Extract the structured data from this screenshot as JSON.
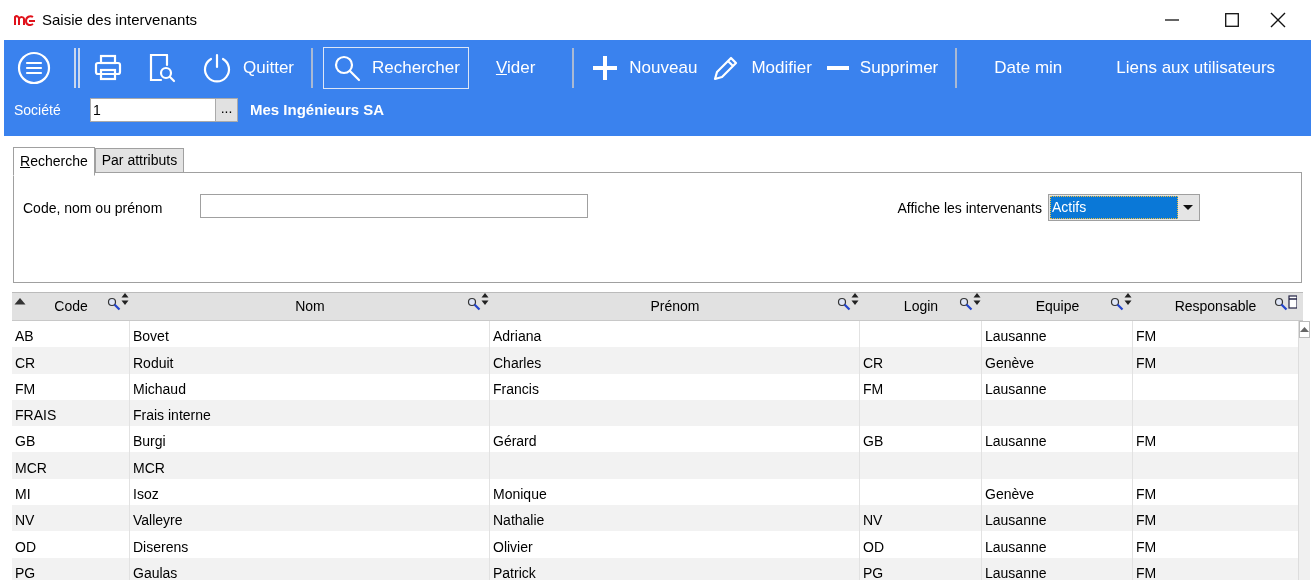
{
  "window": {
    "title": "Saisie des intervenants"
  },
  "toolbar": {
    "items": [
      {
        "kind": "menu"
      },
      {
        "kind": "separator"
      },
      {
        "kind": "print"
      },
      {
        "kind": "preview"
      },
      {
        "kind": "power",
        "label": "Quitter"
      },
      {
        "kind": "separator"
      },
      {
        "kind": "search",
        "label": "Rechercher",
        "selected": true
      },
      {
        "kind": "text",
        "label": "Vider",
        "accelerator": true
      },
      {
        "kind": "separator"
      },
      {
        "kind": "plus",
        "label": "Nouveau"
      },
      {
        "kind": "pencil",
        "label": "Modifier"
      },
      {
        "kind": "minus",
        "label": "Supprimer"
      },
      {
        "kind": "separator"
      },
      {
        "kind": "text",
        "label": "Date min",
        "accelerator": false
      },
      {
        "kind": "text",
        "label": "Liens aux utilisateurs",
        "accelerator": false
      }
    ]
  },
  "company": {
    "label": "Société",
    "value": "1",
    "browse": "...",
    "name": "Mes Ingénieurs SA"
  },
  "tabs": [
    {
      "label": "Recherche",
      "selected": true
    },
    {
      "label": "Par attributs",
      "selected": false
    }
  ],
  "search": {
    "label": "Code, nom ou prénom",
    "filter_label": "Affiche les intervenants",
    "filter_value": "Actifs"
  },
  "table": {
    "columns": [
      "Code",
      "Nom",
      "Prénom",
      "Login",
      "Equipe",
      "Responsable"
    ],
    "rows": [
      [
        "AB",
        "Bovet",
        "Adriana",
        "",
        "Lausanne",
        "FM"
      ],
      [
        "CR",
        "Roduit",
        "Charles",
        "CR",
        "Genève",
        "FM"
      ],
      [
        "FM",
        "Michaud",
        "Francis",
        "FM",
        "Lausanne",
        ""
      ],
      [
        "FRAIS",
        "Frais interne",
        "",
        "",
        "",
        ""
      ],
      [
        "GB",
        "Burgi",
        "Gérard",
        "GB",
        "Lausanne",
        "FM"
      ],
      [
        "MCR",
        "MCR",
        "",
        "",
        "",
        ""
      ],
      [
        "MI",
        "Isoz",
        "Monique",
        "",
        "Genève",
        "FM"
      ],
      [
        "NV",
        "Valleyre",
        "Nathalie",
        "NV",
        "Lausanne",
        "FM"
      ],
      [
        "OD",
        "Diserens",
        "Olivier",
        "OD",
        "Lausanne",
        "FM"
      ],
      [
        "PG",
        "Gaulas",
        "Patrick",
        "PG",
        "Lausanne",
        "FM"
      ]
    ]
  }
}
